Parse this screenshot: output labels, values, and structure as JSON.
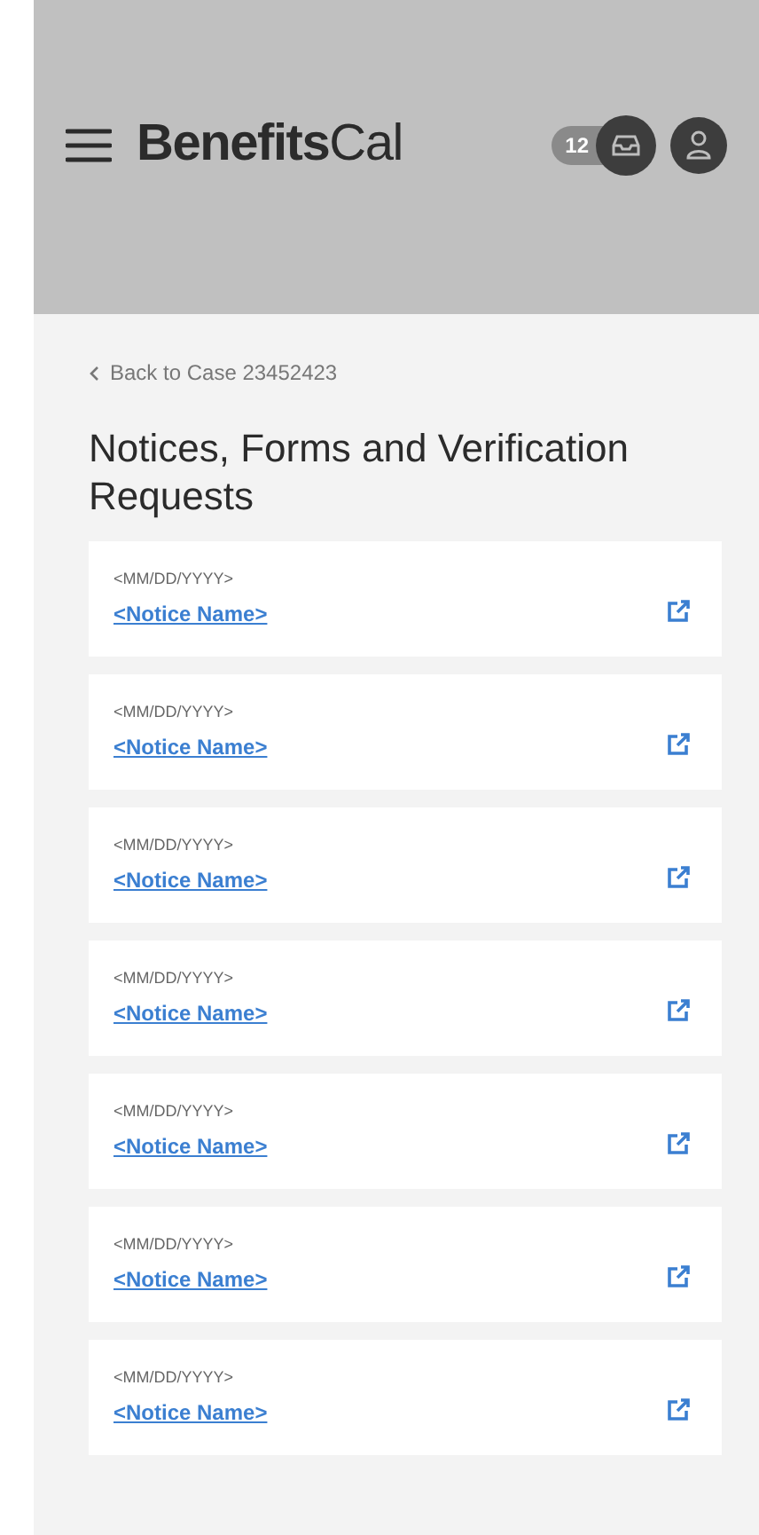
{
  "header": {
    "brand_bold": "Benefits",
    "brand_regular": "Cal",
    "inbox_count": "12"
  },
  "back_link": "Back to Case 23452423",
  "title": "Notices, Forms and Verification Requests",
  "notices": [
    {
      "date": "<MM/DD/YYYY>",
      "name": "<Notice Name>"
    },
    {
      "date": "<MM/DD/YYYY>",
      "name": "<Notice Name>"
    },
    {
      "date": "<MM/DD/YYYY>",
      "name": "<Notice Name>"
    },
    {
      "date": "<MM/DD/YYYY>",
      "name": "<Notice Name>"
    },
    {
      "date": "<MM/DD/YYYY>",
      "name": "<Notice Name>"
    },
    {
      "date": "<MM/DD/YYYY>",
      "name": "<Notice Name>"
    },
    {
      "date": "<MM/DD/YYYY>",
      "name": "<Notice Name>"
    }
  ]
}
